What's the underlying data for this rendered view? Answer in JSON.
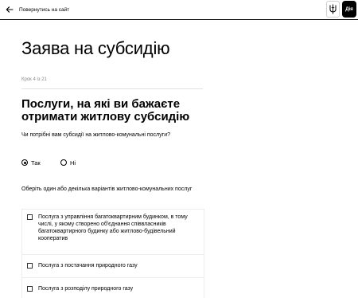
{
  "header": {
    "back_label": "Повернутись на сайт",
    "logo_text": "Дія"
  },
  "page": {
    "title": "Заява на субсидію",
    "step": "Крок 4 із 21",
    "question_title": "Послуги, на які ви бажаєте отримати житлову субсидію"
  },
  "subsidy_question": {
    "label": "Чи потрібні вам субсидії на житлово-комунальні послуги?",
    "options": [
      {
        "label": "Так",
        "selected": true
      },
      {
        "label": "Ні",
        "selected": false
      }
    ]
  },
  "services_question": {
    "label": "Оберіть один або декілька варіантів житлово-комунальних послуг",
    "options": [
      {
        "label": "Послуга з управління багатоквартирним будинком, в тому числі, у якому створено об'єднання співвласників багатоквартирного будинку або житлово-будівельний кооператив",
        "checked": false
      },
      {
        "label": "Послуга з постачання природного газу",
        "checked": false
      },
      {
        "label": "Послуга з розподілу природного газу",
        "checked": false
      }
    ]
  }
}
